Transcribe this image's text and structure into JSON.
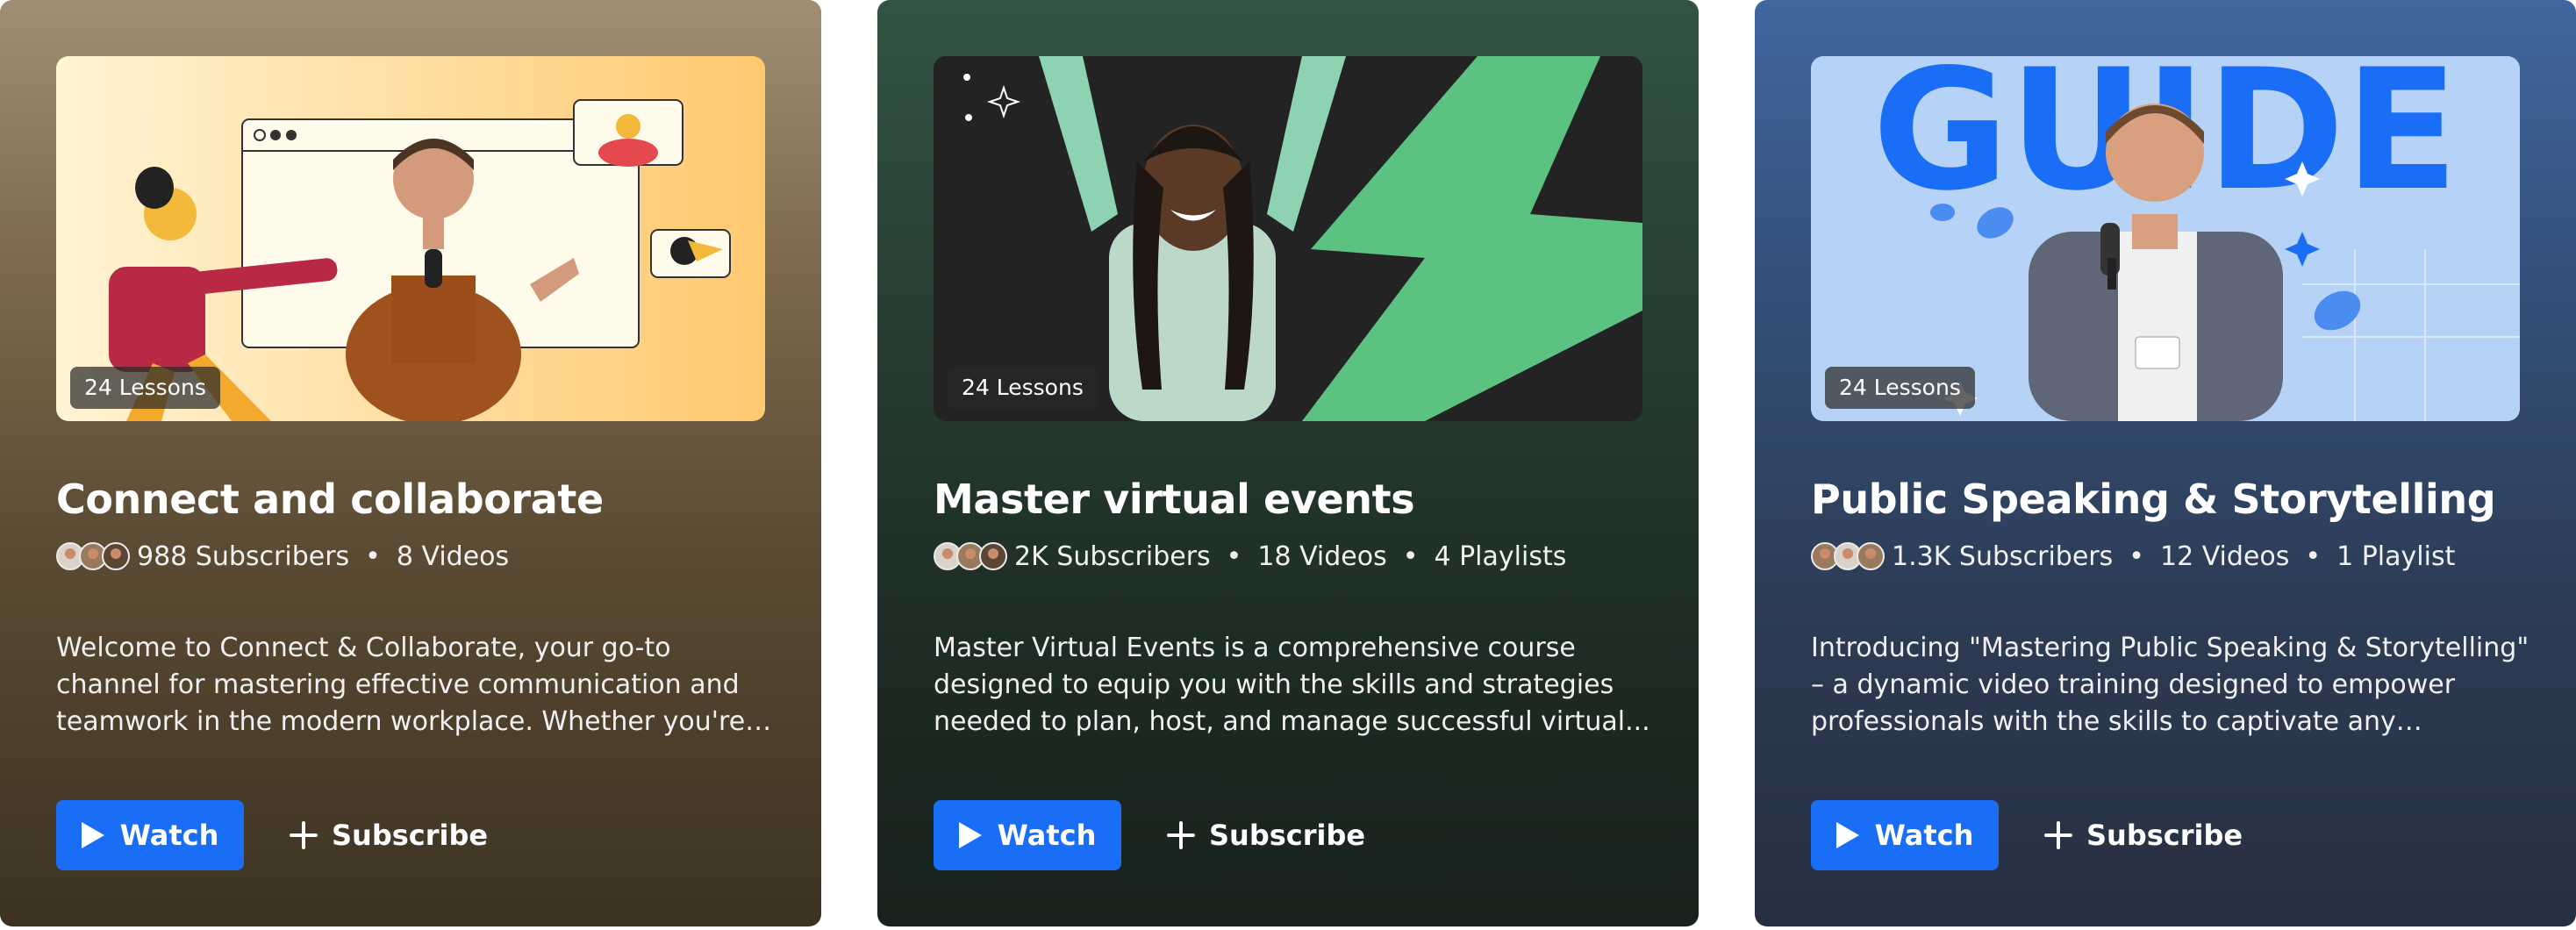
{
  "cards": [
    {
      "lessons": "24 Lessons",
      "title": "Connect and collaborate",
      "subscribers": "988 Subscribers",
      "videos": "8 Videos",
      "playlists": "",
      "description": "Welcome to Connect & Collaborate, your go-to channel for mastering effective communication and teamwork in the modern workplace. Whether you're a team leader...",
      "watch_label": "Watch",
      "subscribe_label": "Subscribe",
      "theme": "brown"
    },
    {
      "lessons": "24 Lessons",
      "title": "Master virtual events",
      "subscribers": "2K Subscribers",
      "videos": "18 Videos",
      "playlists": "4 Playlists",
      "description": "Master Virtual Events is a comprehensive course designed to equip you with the skills and strategies needed to plan, host, and manage successful virtual...",
      "watch_label": "Watch",
      "subscribe_label": "Subscribe",
      "theme": "green"
    },
    {
      "lessons": "24 Lessons",
      "title": "Public Speaking & Storytelling",
      "subscribers": "1.3K Subscribers",
      "videos": "12 Videos",
      "playlists": "1 Playlist",
      "description": "Introducing \"Mastering Public Speaking & Storytelling\" – a dynamic video training designed to empower professionals with the skills to captivate any audience.",
      "watch_label": "Watch",
      "subscribe_label": "Subscribe",
      "theme": "blue",
      "thumbnail_text": "GUIDE"
    }
  ],
  "separator": "•",
  "colors": {
    "accent": "#1a6ef5",
    "card_brown": "#7d6a4e",
    "card_green": "#253b2f",
    "card_blue": "#34507a"
  }
}
